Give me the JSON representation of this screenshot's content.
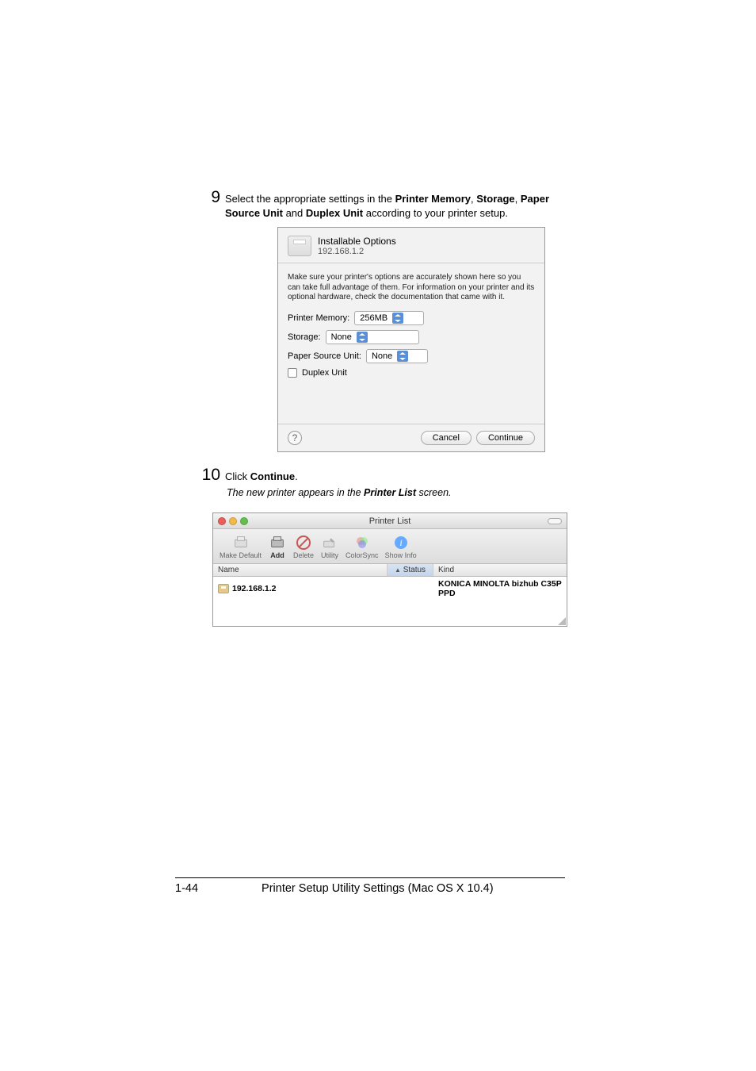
{
  "step9": {
    "num": "9",
    "text_pre": "Select the appropriate settings in the ",
    "b1": "Printer Memory",
    "c1": ", ",
    "b2": "Storage",
    "c2": ", ",
    "b3": "Paper Source Unit",
    "c3": " and ",
    "b4": "Duplex Unit",
    "c4": " according to your printer setup."
  },
  "dialog": {
    "title": "Installable Options",
    "ip": "192.168.1.2",
    "note": "Make sure your printer's options are accurately shown here so you can take full advantage of them.  For information on your printer and its optional hardware, check the documentation that came with it.",
    "memory_label": "Printer Memory:",
    "memory_value": "256MB",
    "storage_label": "Storage:",
    "storage_value": "None",
    "psu_label": "Paper Source Unit:",
    "psu_value": "None",
    "duplex_label": "Duplex Unit",
    "help": "?",
    "cancel": "Cancel",
    "continue": "Continue"
  },
  "step10": {
    "num": "10",
    "text_pre": "Click ",
    "b1": "Continue",
    "c1": ".",
    "note_pre": "The new printer appears in the ",
    "note_b": "Printer List",
    "note_post": " screen."
  },
  "printerList": {
    "title": "Printer List",
    "toolbar": {
      "make_default": "Make Default",
      "add": "Add",
      "delete": "Delete",
      "utility": "Utility",
      "colorsync": "ColorSync",
      "show_info": "Show Info"
    },
    "cols": {
      "name": "Name",
      "status": "Status",
      "kind": "Kind"
    },
    "row": {
      "name": "192.168.1.2",
      "kind": "KONICA MINOLTA bizhub C35P PPD"
    }
  },
  "footer": {
    "page": "1-44",
    "title": "Printer Setup Utility Settings (Mac OS X 10.4)"
  }
}
